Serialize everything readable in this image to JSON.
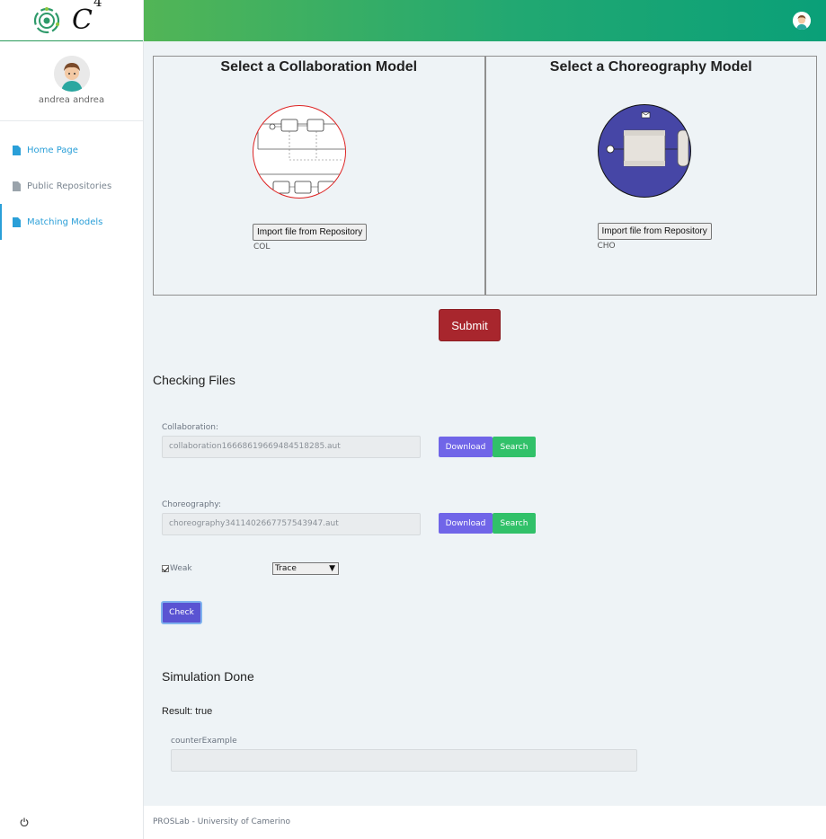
{
  "app": {
    "logo_text": "C",
    "logo_sup": "4"
  },
  "sidebar": {
    "user_name": "andrea andrea",
    "items": [
      {
        "label": "Home Page"
      },
      {
        "label": "Public Repositories"
      },
      {
        "label": "Matching Models"
      }
    ]
  },
  "panels": {
    "collaboration": {
      "title": "Select a Collaboration Model",
      "import_label": "Import file from Repository",
      "tag": "COL"
    },
    "choreography": {
      "title": "Select a Choreography Model",
      "import_label": "Import file from Repository",
      "tag": "CHO"
    }
  },
  "submit_label": "Submit",
  "checking": {
    "title": "Checking Files",
    "collaboration": {
      "label": "Collaboration:",
      "value": "collaboration16668619669484518285.aut",
      "download_label": "Download",
      "search_label": "Search"
    },
    "choreography": {
      "label": "Choreography:",
      "value": "choreography3411402667757543947.aut",
      "download_label": "Download",
      "search_label": "Search"
    },
    "weak_label": "Weak",
    "equivalence_selected": "Trace",
    "caret": "▼",
    "check_label": "Check"
  },
  "simulation": {
    "title": "Simulation Done",
    "result": "Result: true",
    "counter_label": "counterExample",
    "counter_value": ""
  },
  "footer": {
    "text": "PROSLab - University of Camerino"
  },
  "colors": {
    "accent_blue": "#2a9fd8",
    "submit_red": "#a8262d",
    "download_purple": "#7065e8",
    "search_green": "#31c169",
    "header_green": "#21a872"
  }
}
